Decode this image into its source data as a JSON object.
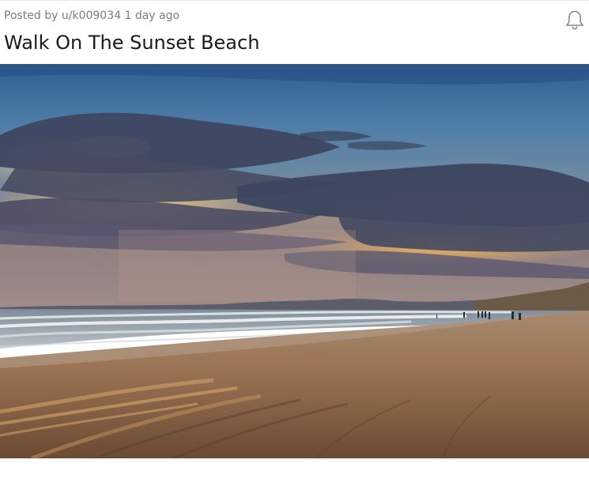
{
  "post": {
    "author_prefix": "Posted by",
    "author": "u/k009034",
    "time_ago": "1 day ago",
    "title": "Walk On The Sunset Beach"
  },
  "icons": {
    "notify": "bell-icon"
  },
  "image": {
    "subject": "sunset-beach-photo"
  }
}
